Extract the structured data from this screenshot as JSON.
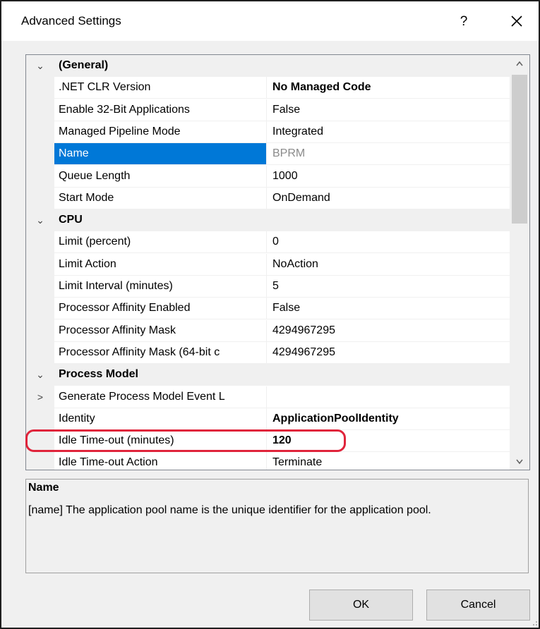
{
  "window": {
    "title": "Advanced Settings",
    "help_label": "?",
    "close_icon": "close-icon"
  },
  "property_grid": {
    "rows": [
      {
        "type": "category",
        "expander": "⌄",
        "label": "(General)"
      },
      {
        "type": "property",
        "label": ".NET CLR Version",
        "value": "No Managed Code",
        "value_bold": true
      },
      {
        "type": "property",
        "label": "Enable 32-Bit Applications",
        "value": "False"
      },
      {
        "type": "property",
        "label": "Managed Pipeline Mode",
        "value": "Integrated"
      },
      {
        "type": "property",
        "label": "Name",
        "value": "BPRM",
        "selected": true
      },
      {
        "type": "property",
        "label": "Queue Length",
        "value": "1000"
      },
      {
        "type": "property",
        "label": "Start Mode",
        "value": "OnDemand"
      },
      {
        "type": "category",
        "expander": "⌄",
        "label": "CPU"
      },
      {
        "type": "property",
        "label": "Limit (percent)",
        "value": "0"
      },
      {
        "type": "property",
        "label": "Limit Action",
        "value": "NoAction"
      },
      {
        "type": "property",
        "label": "Limit Interval (minutes)",
        "value": "5"
      },
      {
        "type": "property",
        "label": "Processor Affinity Enabled",
        "value": "False"
      },
      {
        "type": "property",
        "label": "Processor Affinity Mask",
        "value": "4294967295"
      },
      {
        "type": "property",
        "label": "Processor Affinity Mask (64-bit c",
        "value": "4294967295"
      },
      {
        "type": "category",
        "expander": "⌄",
        "label": "Process Model"
      },
      {
        "type": "property",
        "expander": ">",
        "label": "Generate Process Model Event L",
        "value": ""
      },
      {
        "type": "property",
        "label": "Identity",
        "value": "ApplicationPoolIdentity",
        "value_bold": true
      },
      {
        "type": "property",
        "label": "Idle Time-out (minutes)",
        "value": "120",
        "value_bold": true,
        "highlighted": true
      },
      {
        "type": "property",
        "label": "Idle Time-out Action",
        "value": "Terminate"
      }
    ],
    "scrollbar": {
      "up_icon": "chevron-up-icon",
      "down_icon": "chevron-down-icon"
    }
  },
  "description": {
    "title": "Name",
    "text": "[name] The application pool name is the unique identifier for the application pool."
  },
  "buttons": {
    "ok": "OK",
    "cancel": "Cancel"
  },
  "colors": {
    "selection": "#0078d7",
    "highlight_ring": "#e0243b",
    "dialog_background": "#f0f0f0"
  }
}
